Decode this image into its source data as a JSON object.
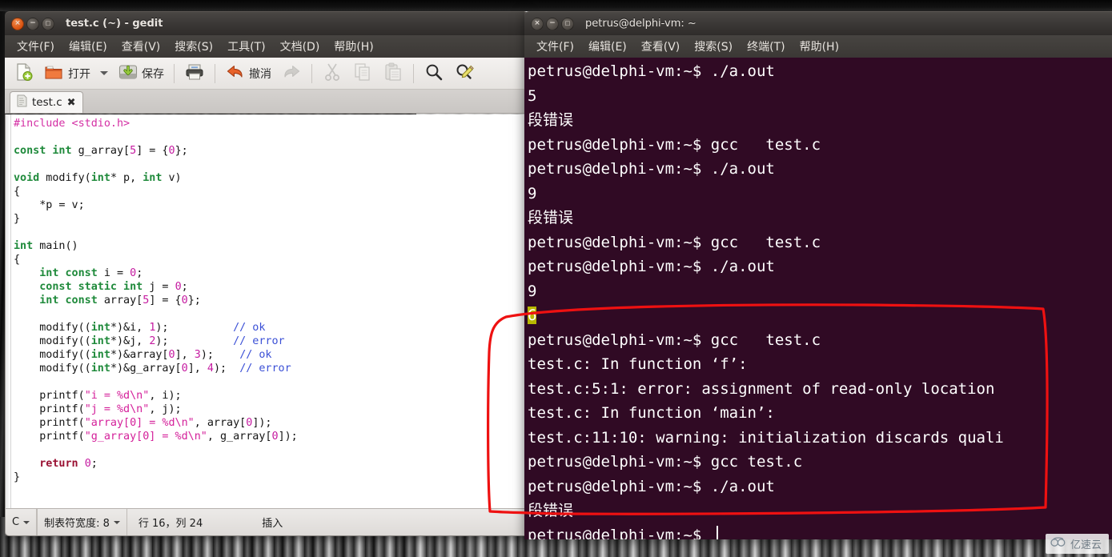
{
  "desktop": {
    "wallpaper_style": "grayscale-building-photo"
  },
  "gedit": {
    "title": "test.c (~) - gedit",
    "window_buttons": {
      "close": "×",
      "minimize": "−",
      "maximize": "□"
    },
    "menu": [
      {
        "label": "文件(F)"
      },
      {
        "label": "编辑(E)"
      },
      {
        "label": "查看(V)"
      },
      {
        "label": "搜索(S)"
      },
      {
        "label": "工具(T)"
      },
      {
        "label": "文档(D)"
      },
      {
        "label": "帮助(H)"
      }
    ],
    "toolbar": [
      {
        "icon": "new-document-icon",
        "label": ""
      },
      {
        "icon": "open-folder-icon",
        "label": "打开"
      },
      {
        "icon": "chevron-down-icon",
        "label": ""
      },
      {
        "icon": "save-icon",
        "label": "保存"
      },
      {
        "icon": "print-icon",
        "label": ""
      },
      {
        "icon": "undo-icon",
        "label": "撤消"
      },
      {
        "icon": "redo-icon",
        "label": ""
      },
      {
        "icon": "cut-icon",
        "label": ""
      },
      {
        "icon": "copy-icon",
        "label": ""
      },
      {
        "icon": "paste-icon",
        "label": ""
      },
      {
        "icon": "search-icon",
        "label": ""
      },
      {
        "icon": "find-replace-icon",
        "label": ""
      }
    ],
    "tab": {
      "title": "test.c",
      "close": "✖"
    },
    "statusbar": {
      "language": "C",
      "tab_width": "制表符宽度: 8",
      "position": "行 16，列 24",
      "mode": "插入"
    },
    "code_lines": [
      [
        {
          "t": "#include <stdio.h>",
          "c": "pp"
        }
      ],
      [],
      [
        {
          "t": "const int",
          "c": "k"
        },
        {
          "t": " g_array[",
          "c": ""
        },
        {
          "t": "5",
          "c": "nm"
        },
        {
          "t": "] = {",
          "c": ""
        },
        {
          "t": "0",
          "c": "nm"
        },
        {
          "t": "};",
          "c": ""
        }
      ],
      [],
      [
        {
          "t": "void",
          "c": "k"
        },
        {
          "t": " modify(",
          "c": ""
        },
        {
          "t": "int",
          "c": "k"
        },
        {
          "t": "* p, ",
          "c": ""
        },
        {
          "t": "int",
          "c": "k"
        },
        {
          "t": " v)",
          "c": ""
        }
      ],
      [
        {
          "t": "{",
          "c": ""
        }
      ],
      [
        {
          "t": "    *p = v;",
          "c": ""
        }
      ],
      [
        {
          "t": "}",
          "c": ""
        }
      ],
      [],
      [
        {
          "t": "int",
          "c": "k"
        },
        {
          "t": " main()",
          "c": ""
        }
      ],
      [
        {
          "t": "{",
          "c": ""
        }
      ],
      [
        {
          "t": "    int const",
          "c": "k"
        },
        {
          "t": " i = ",
          "c": ""
        },
        {
          "t": "0",
          "c": "nm"
        },
        {
          "t": ";",
          "c": ""
        }
      ],
      [
        {
          "t": "    const static int",
          "c": "k"
        },
        {
          "t": " j = ",
          "c": ""
        },
        {
          "t": "0",
          "c": "nm"
        },
        {
          "t": ";",
          "c": ""
        }
      ],
      [
        {
          "t": "    int const",
          "c": "k"
        },
        {
          "t": " array[",
          "c": ""
        },
        {
          "t": "5",
          "c": "nm"
        },
        {
          "t": "] = {",
          "c": ""
        },
        {
          "t": "0",
          "c": "nm"
        },
        {
          "t": "};",
          "c": ""
        }
      ],
      [],
      [
        {
          "t": "    modify((",
          "c": ""
        },
        {
          "t": "int",
          "c": "k"
        },
        {
          "t": "*)&i, ",
          "c": ""
        },
        {
          "t": "1",
          "c": "nm"
        },
        {
          "t": ");          ",
          "c": ""
        },
        {
          "t": "// ok",
          "c": "cm"
        }
      ],
      [
        {
          "t": "    modify((",
          "c": ""
        },
        {
          "t": "int",
          "c": "k"
        },
        {
          "t": "*)&j, ",
          "c": ""
        },
        {
          "t": "2",
          "c": "nm"
        },
        {
          "t": ");          ",
          "c": ""
        },
        {
          "t": "// error",
          "c": "cm"
        }
      ],
      [
        {
          "t": "    modify((",
          "c": ""
        },
        {
          "t": "int",
          "c": "k"
        },
        {
          "t": "*)&array[",
          "c": ""
        },
        {
          "t": "0",
          "c": "nm"
        },
        {
          "t": "], ",
          "c": ""
        },
        {
          "t": "3",
          "c": "nm"
        },
        {
          "t": ");    ",
          "c": ""
        },
        {
          "t": "// ok",
          "c": "cm"
        }
      ],
      [
        {
          "t": "    modify((",
          "c": ""
        },
        {
          "t": "int",
          "c": "k"
        },
        {
          "t": "*)&g_array[",
          "c": ""
        },
        {
          "t": "0",
          "c": "nm"
        },
        {
          "t": "], ",
          "c": ""
        },
        {
          "t": "4",
          "c": "nm"
        },
        {
          "t": ");  ",
          "c": ""
        },
        {
          "t": "// error",
          "c": "cm"
        }
      ],
      [],
      [
        {
          "t": "    printf(",
          "c": ""
        },
        {
          "t": "\"i = %d\\n\"",
          "c": "st"
        },
        {
          "t": ", i);",
          "c": ""
        }
      ],
      [
        {
          "t": "    printf(",
          "c": ""
        },
        {
          "t": "\"j = %d\\n\"",
          "c": "st"
        },
        {
          "t": ", j);",
          "c": ""
        }
      ],
      [
        {
          "t": "    printf(",
          "c": ""
        },
        {
          "t": "\"array[0] = %d\\n\"",
          "c": "st"
        },
        {
          "t": ", array[",
          "c": ""
        },
        {
          "t": "0",
          "c": "nm"
        },
        {
          "t": "]);",
          "c": ""
        }
      ],
      [
        {
          "t": "    printf(",
          "c": ""
        },
        {
          "t": "\"g_array[0] = %d\\n\"",
          "c": "st"
        },
        {
          "t": ", g_array[",
          "c": ""
        },
        {
          "t": "0",
          "c": "nm"
        },
        {
          "t": "]);",
          "c": ""
        }
      ],
      [],
      [
        {
          "t": "    return",
          "c": "rt"
        },
        {
          "t": " ",
          "c": ""
        },
        {
          "t": "0",
          "c": "nm"
        },
        {
          "t": ";",
          "c": ""
        }
      ],
      [
        {
          "t": "}",
          "c": ""
        }
      ]
    ]
  },
  "terminal": {
    "title": "petrus@delphi-vm: ~",
    "window_buttons": {
      "close": "×",
      "minimize": "−",
      "maximize": "□"
    },
    "menu": [
      {
        "label": "文件(F)"
      },
      {
        "label": "编辑(E)"
      },
      {
        "label": "查看(V)"
      },
      {
        "label": "搜索(S)"
      },
      {
        "label": "终端(T)"
      },
      {
        "label": "帮助(H)"
      }
    ],
    "prompt": "petrus@delphi-vm:~$",
    "background_color": "#300a24",
    "lines": [
      {
        "text": "petrus@delphi-vm:~$ ./a.out"
      },
      {
        "text": "5"
      },
      {
        "text": "段错误"
      },
      {
        "text": "petrus@delphi-vm:~$ gcc   test.c"
      },
      {
        "text": "petrus@delphi-vm:~$ ./a.out"
      },
      {
        "text": "9"
      },
      {
        "text": "段错误"
      },
      {
        "text": "petrus@delphi-vm:~$ gcc   test.c"
      },
      {
        "text": "petrus@delphi-vm:~$ ./a.out"
      },
      {
        "text": "9"
      },
      {
        "text": "6",
        "highlight": true
      },
      {
        "text": "petrus@delphi-vm:~$ gcc   test.c"
      },
      {
        "text": "test.c: In function ‘f’:"
      },
      {
        "text": "test.c:5:1: error: assignment of read-only location"
      },
      {
        "text": "test.c: In function ‘main’:"
      },
      {
        "text": "test.c:11:10: warning: initialization discards quali"
      },
      {
        "text": "petrus@delphi-vm:~$ gcc test.c"
      },
      {
        "text": "petrus@delphi-vm:~$ ./a.out"
      },
      {
        "text": "段错误"
      },
      {
        "text": "petrus@delphi-vm:~$ ",
        "cursor": true
      }
    ]
  },
  "annotation": {
    "color": "#ee1111",
    "shape": "hand-drawn-rectangle"
  },
  "watermark": {
    "text": "亿速云",
    "icon": "cloud-icon"
  }
}
